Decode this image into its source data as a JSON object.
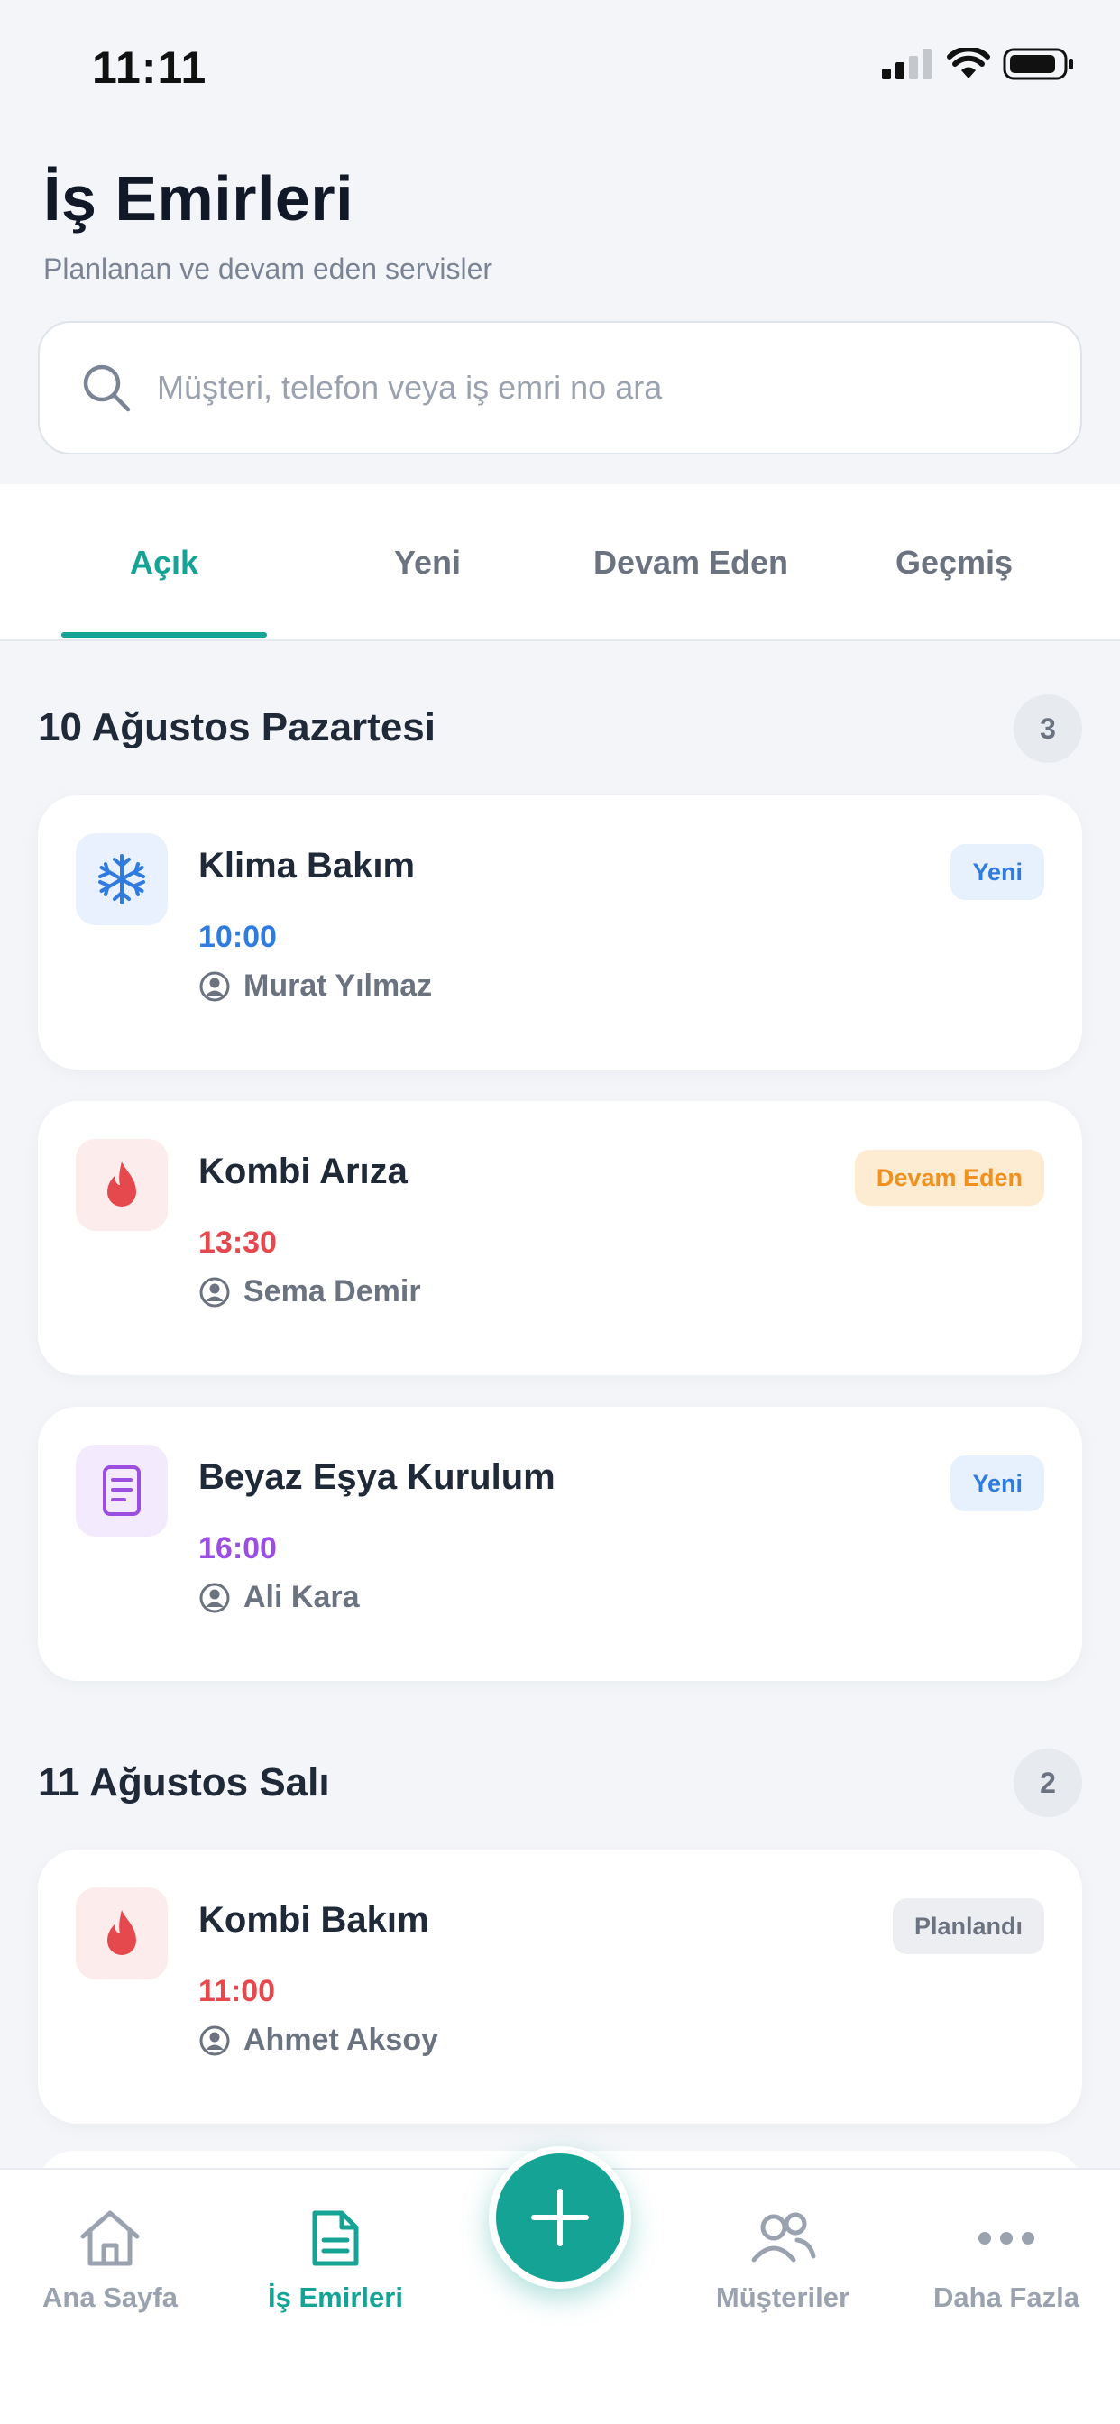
{
  "status_bar": {
    "time": "11:11"
  },
  "header": {
    "title": "İş Emirleri",
    "subtitle": "Planlanan ve devam eden servisler"
  },
  "search": {
    "placeholder": "Müşteri, telefon veya iş emri no ara",
    "value": "",
    "icon": "search-icon"
  },
  "tabs": [
    {
      "label": "Açık",
      "active": true
    },
    {
      "label": "Yeni",
      "active": false
    },
    {
      "label": "Devam Eden",
      "active": false
    },
    {
      "label": "Geçmiş",
      "active": false
    }
  ],
  "sections": [
    {
      "title": "10 Ağustos Pazartesi",
      "count": "3",
      "items": [
        {
          "title": "Klima Bakım",
          "time": "10:00",
          "person": "Murat Yılmaz",
          "status": "Yeni",
          "icon": "snowflake-icon",
          "accent": "#2f7be0",
          "status_color": "#2f7be0"
        },
        {
          "title": "Kombi Arıza",
          "time": "13:30",
          "person": "Sema Demir",
          "status": "Devam Eden",
          "icon": "flame-icon",
          "accent": "#e5484d",
          "status_color": "#f0901e"
        },
        {
          "title": "Beyaz Eşya Kurulum",
          "time": "16:00",
          "person": "Ali Kara",
          "status": "Yeni",
          "icon": "document-icon",
          "accent": "#9a4fe0",
          "status_color": "#2f7be0"
        }
      ]
    },
    {
      "title": "11 Ağustos Salı",
      "count": "2",
      "items": [
        {
          "title": "Kombi Bakım",
          "time": "11:00",
          "person": "Ahmet Aksoy",
          "status": "Planlandı",
          "icon": "flame-icon",
          "accent": "#e5484d",
          "status_color": "#6b7280"
        }
      ]
    }
  ],
  "bottom_nav": [
    {
      "label": "Ana Sayfa",
      "icon": "home-icon",
      "active": false
    },
    {
      "label": "İş Emirleri",
      "icon": "document-icon",
      "active": true
    },
    {
      "label": "Müşteriler",
      "icon": "users-icon",
      "active": false
    },
    {
      "label": "Daha Fazla",
      "icon": "more-icon",
      "active": false
    }
  ],
  "fab": {
    "icon": "plus-icon"
  },
  "colors": {
    "accent": "#14a394",
    "background": "#f3f5f8"
  }
}
